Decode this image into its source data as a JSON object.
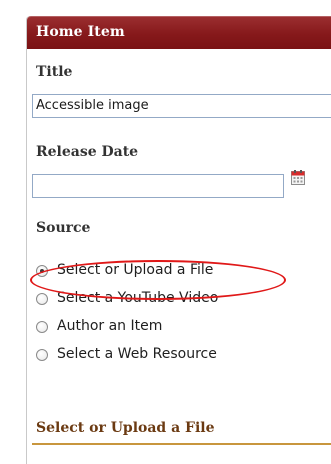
{
  "panel": {
    "title": "Home Item"
  },
  "fields": {
    "title_label": "Title",
    "title_value": "Accessible image",
    "release_date_label": "Release Date",
    "release_date_value": ""
  },
  "source": {
    "label": "Source",
    "options": [
      {
        "label": "Select or Upload a File",
        "selected": true
      },
      {
        "label": "Select a YouTube Video",
        "selected": false
      },
      {
        "label": "Author an Item",
        "selected": false
      },
      {
        "label": "Select a Web Resource",
        "selected": false
      }
    ]
  },
  "section": {
    "title": "Select or Upload a File"
  },
  "colors": {
    "header": "#86191b",
    "highlight": "#e01818",
    "section_rule": "#c8963e"
  },
  "icons": {
    "calendar": "calendar-icon"
  }
}
